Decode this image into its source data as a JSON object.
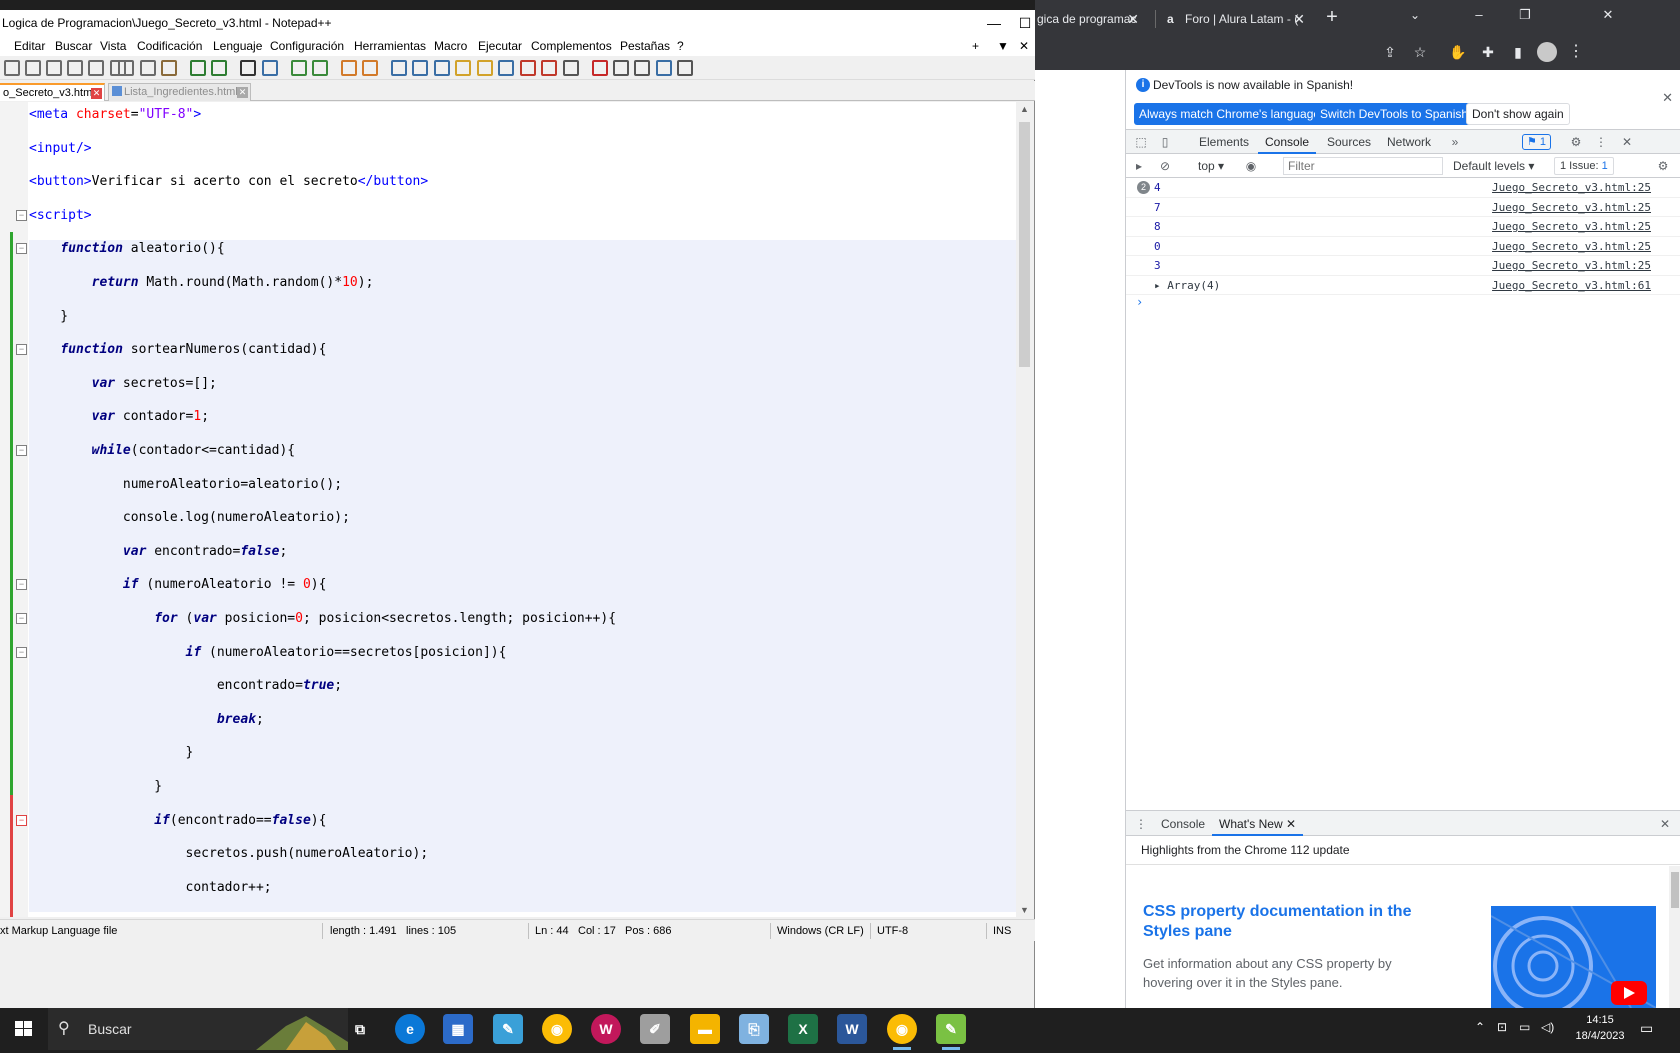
{
  "npp": {
    "title": "Logica de Programacion\\Juego_Secreto_v3.html - Notepad++",
    "menu": [
      "Editar",
      "Buscar",
      "Vista",
      "Codificación",
      "Lenguaje",
      "Configuración",
      "Herramientas",
      "Macro",
      "Ejecutar",
      "Complementos",
      "Pestañas",
      "?"
    ],
    "tabs": [
      {
        "label": "o_Secreto_v3.html",
        "active": true
      },
      {
        "label": "Lista_Ingredientes.html",
        "active": false
      }
    ],
    "code_lines": [
      "<meta charset=\"UTF-8\">",
      "<input/>",
      "<button>Verificar si acerto con el secreto</button>",
      "<script>",
      "    function aleatorio(){",
      "        return Math.round(Math.random()*10);",
      "    }",
      "    function sortearNumeros(cantidad){",
      "        var secretos=[];",
      "        var contador=1;",
      "        while(contador<=cantidad){",
      "            numeroAleatorio=aleatorio();",
      "            console.log(numeroAleatorio);",
      "            var encontrado=false;",
      "            if (numeroAleatorio != 0){",
      "                for (var posicion=0; posicion<secretos.length; posicion++){",
      "                    if (numeroAleatorio==secretos[posicion]){",
      "                        encontrado=true;",
      "                        break;",
      "                    }",
      "                }",
      "                if(encontrado==false){",
      "                    secretos.push(numeroAleatorio);",
      "                    contador++;"
    ],
    "status": {
      "file_type": "xt Markup Language file",
      "length": "length : 1.491",
      "lines": "lines : 105",
      "ln": "Ln : 44",
      "col": "Col : 17",
      "pos": "Pos : 686",
      "eol": "Windows (CR LF)",
      "encoding": "UTF-8",
      "mode": "INS"
    }
  },
  "chrome": {
    "tabs": [
      {
        "label": "gica de programac",
        "icon": "alura-icon"
      },
      {
        "label": "Foro | Alura Latam - (",
        "icon": "alura-a-icon"
      }
    ]
  },
  "devtools": {
    "infobar": {
      "message": "DevTools is now available in Spanish!",
      "btn_match": "Always match Chrome's language",
      "btn_switch": "Switch DevTools to Spanish",
      "btn_dismiss": "Don't show again"
    },
    "tabs": [
      "Elements",
      "Console",
      "Sources",
      "Network"
    ],
    "active_tab": "Console",
    "messages_badge": "1",
    "console_bar": {
      "context": "top",
      "filter_placeholder": "Filter",
      "levels": "Default levels",
      "issues_label": "1 Issue:",
      "issues_count": "1"
    },
    "logs": [
      {
        "count": "2",
        "value": "4",
        "source": "Juego_Secreto_v3.html:25",
        "type": "number"
      },
      {
        "count": "",
        "value": "7",
        "source": "Juego_Secreto_v3.html:25",
        "type": "number"
      },
      {
        "count": "",
        "value": "8",
        "source": "Juego_Secreto_v3.html:25",
        "type": "number"
      },
      {
        "count": "",
        "value": "0",
        "source": "Juego_Secreto_v3.html:25",
        "type": "number"
      },
      {
        "count": "",
        "value": "3",
        "source": "Juego_Secreto_v3.html:25",
        "type": "number"
      },
      {
        "count": "",
        "value": "▸ Array(4)",
        "source": "Juego_Secreto_v3.html:61",
        "type": "object"
      }
    ],
    "drawer": {
      "tabs": [
        "Console",
        "What's New"
      ],
      "active_tab": "What's New",
      "highlights": "Highlights from the Chrome 112 update",
      "feature_title": "CSS property documentation in the Styles pane",
      "feature_desc": "Get information about any CSS property by hovering over it in the Styles pane."
    }
  },
  "taskbar": {
    "search": "Buscar",
    "time": "14:15",
    "date": "18/4/2023"
  }
}
